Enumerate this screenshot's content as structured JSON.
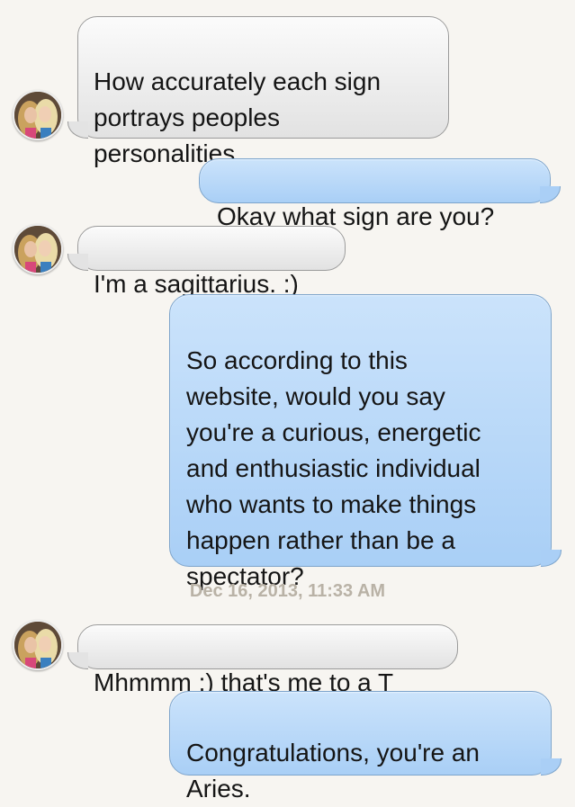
{
  "thread": {
    "messages": [
      {
        "direction": "received",
        "text": "How accurately each sign\nportrays peoples\npersonalities."
      },
      {
        "direction": "sent",
        "text": "Okay what sign are you?"
      },
      {
        "direction": "received",
        "text": "I'm a sagittarius. :)"
      },
      {
        "direction": "sent",
        "text": "So according to this\nwebsite, would you say\nyou're a curious, energetic\nand enthusiastic individual\nwho wants to make things\nhappen rather than be a\nspectator?"
      },
      {
        "direction": "received",
        "text": "Mhmmm :) that's me to a T"
      },
      {
        "direction": "sent",
        "text": "Congratulations, you're an\nAries."
      }
    ],
    "timestamp": "Dec 16, 2013, 11:33 AM"
  },
  "colors": {
    "background": "#f7f5f1",
    "sent_bubble": "#aacff6",
    "received_bubble": "#e6e6e6",
    "timestamp_text": "#b9b2a6"
  },
  "icons": {
    "contact_avatar": "avatar"
  }
}
